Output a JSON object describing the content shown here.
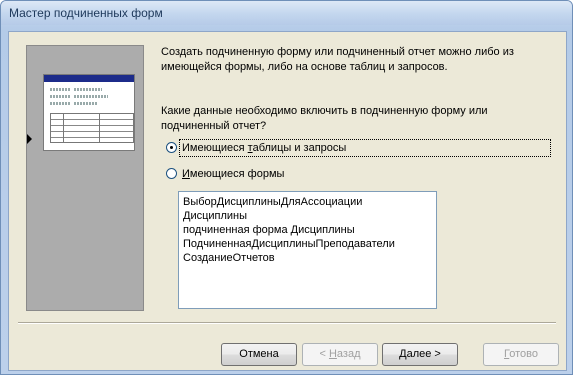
{
  "window": {
    "title": "Мастер подчиненных форм"
  },
  "intro_text_line1": "Создать подчиненную форму или подчиненный отчет можно либо из",
  "intro_text_line2": "имеющейся формы, либо на основе таблиц и запросов.",
  "question_line1": "Какие данные необходимо включить в подчиненную форму или",
  "question_line2": "подчиненный отчет?",
  "options": [
    {
      "label_pre": "Имеющиеся ",
      "label_accel": "т",
      "label_post": "аблицы и запросы",
      "checked": true
    },
    {
      "label_pre": "",
      "label_accel": "И",
      "label_post": "меющиеся формы",
      "checked": false
    }
  ],
  "forms_list": [
    "ВыборДисциплиныДляАссоциации",
    "Дисциплины",
    "подчиненная форма Дисциплины",
    "ПодчиненнаяДисциплиныПреподаватели",
    "СозданиеОтчетов"
  ],
  "buttons": {
    "cancel": "Отмена",
    "back_pre": "< ",
    "back_accel": "Н",
    "back_post": "азад",
    "next_pre": "",
    "next_accel": "Д",
    "next_post": "алее >",
    "finish_pre": "",
    "finish_accel": "Г",
    "finish_post": "отово"
  }
}
